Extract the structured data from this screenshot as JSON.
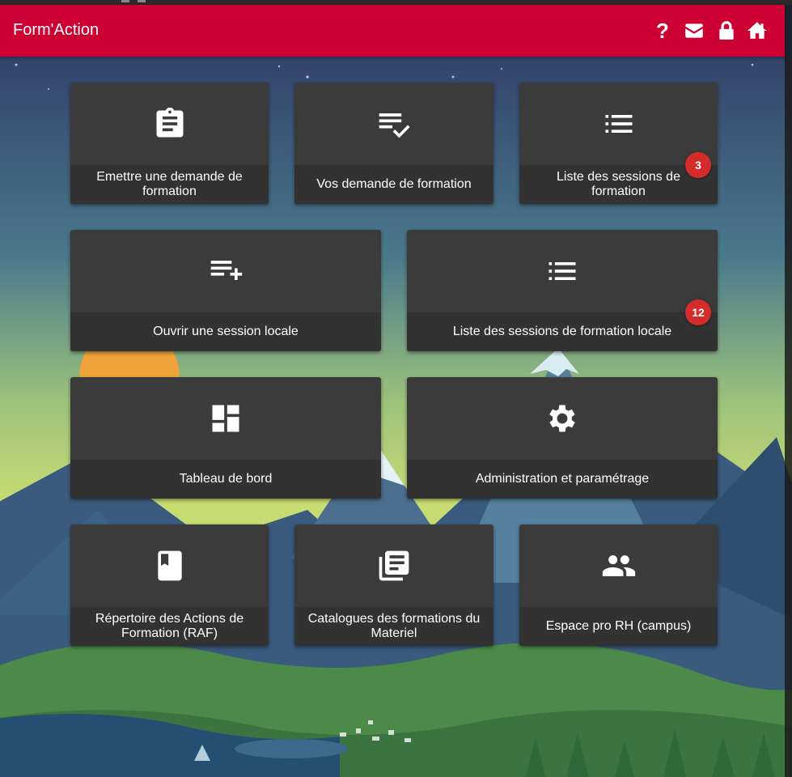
{
  "header": {
    "title": "Form'Action",
    "help_symbol": "?",
    "icons": [
      "help-icon",
      "mail-icon",
      "lock-icon",
      "home-icon"
    ],
    "color": "#cc0033"
  },
  "tiles": [
    {
      "label": "Emettre une demande de formation",
      "icon": "clipboard-icon"
    },
    {
      "label": "Vos demande de formation",
      "icon": "list-check-icon"
    },
    {
      "label": "Liste des sessions de formation",
      "icon": "list-icon",
      "badge": "3"
    },
    {
      "label": "Ouvrir une session locale",
      "icon": "playlist-add-icon"
    },
    {
      "label": "Liste des sessions de formation locale",
      "icon": "list-icon",
      "badge": "12"
    },
    {
      "label": "Tableau de bord",
      "icon": "dashboard-icon"
    },
    {
      "label": "Administration et paramétrage",
      "icon": "gear-icon"
    },
    {
      "label": "Répertoire des Actions de Formation (RAF)",
      "icon": "book-icon"
    },
    {
      "label": "Catalogues des formations du Materiel",
      "icon": "library-books-icon"
    },
    {
      "label": "Espace pro RH (campus)",
      "icon": "people-icon"
    }
  ],
  "colors": {
    "badge": "#d52b2b",
    "tile": "#3b3b3b",
    "tile_label": "#323232"
  }
}
